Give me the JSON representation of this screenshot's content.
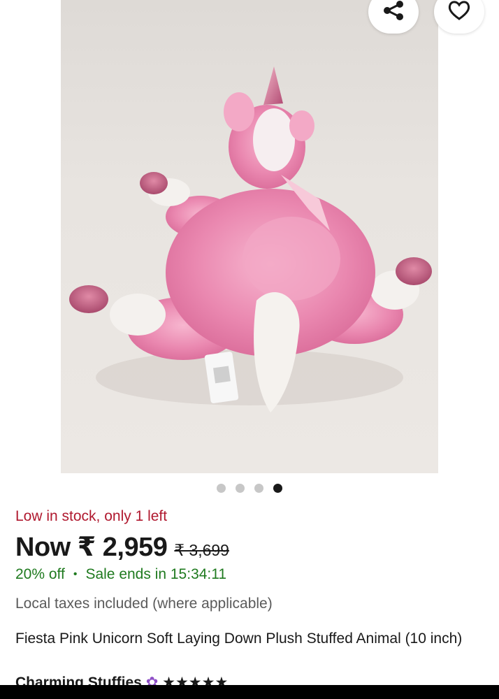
{
  "image": {
    "alt": "Pink unicorn plush lying face down",
    "gallery_count": 4,
    "active_index": 3
  },
  "actions": {
    "share_icon": "share-icon",
    "favorite_icon": "heart-icon"
  },
  "stock_text": "Low in stock, only 1 left",
  "price": {
    "now": "Now ₹ 2,959",
    "was": "₹ 3,699"
  },
  "sale": {
    "discount": "20% off",
    "separator": "•",
    "ends": "Sale ends in 15:34:11"
  },
  "taxes_note": "Local taxes included (where applicable)",
  "title": "Fiesta Pink Unicorn Soft Laying Down Plush Stuffed Animal (10 inch)",
  "seller": {
    "name": "Charming Stuffies",
    "stars": "★★★★★"
  },
  "colors": {
    "stock": "#b0192f",
    "sale": "#1f7a1f",
    "plush": "#e77aa5"
  }
}
